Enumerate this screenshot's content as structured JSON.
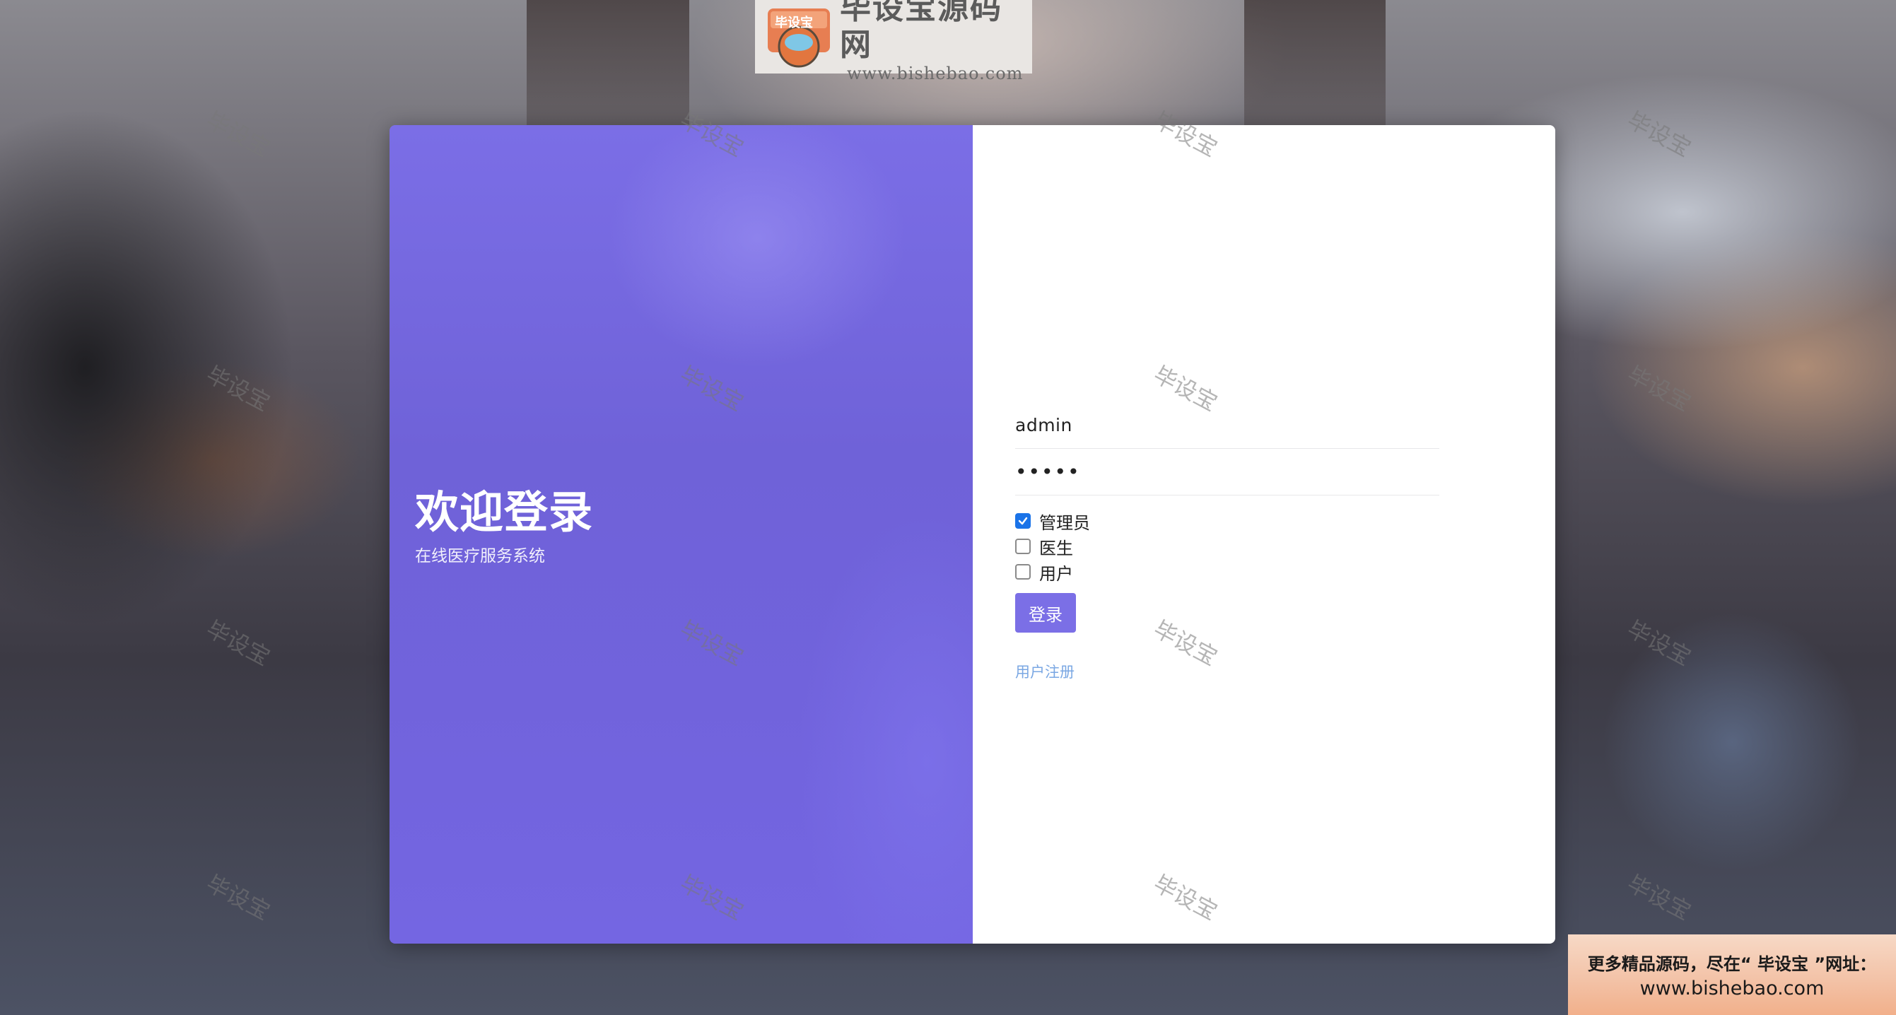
{
  "logo": {
    "badge_text": "毕设宝",
    "name": "毕设宝源码网",
    "url": "www.bishebao.com"
  },
  "watermark_text": "毕设宝",
  "welcome": {
    "title": "欢迎登录",
    "subtitle": "在线医疗服务系统"
  },
  "form": {
    "username_value": "admin",
    "password_value": "•••••",
    "roles": [
      {
        "label": "管理员",
        "checked": true
      },
      {
        "label": "医生",
        "checked": false
      },
      {
        "label": "用户",
        "checked": false
      }
    ],
    "login_label": "登录",
    "register_label": "用户注册"
  },
  "ad": {
    "line1": "更多精品源码，尽在“ 毕设宝 ”网址：",
    "line2": "www.bishebao.com"
  },
  "colors": {
    "accent": "#7b6fe6",
    "checkbox_checked": "#1a73e8",
    "link": "#7aa7e3"
  }
}
